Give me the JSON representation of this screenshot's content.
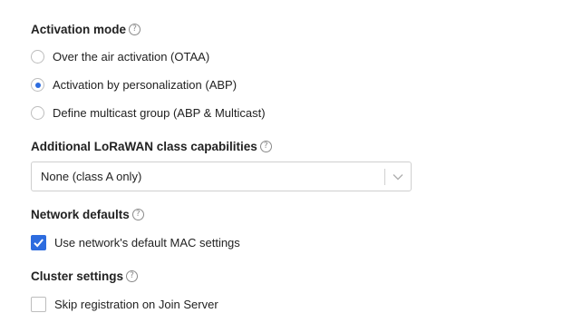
{
  "activation_mode": {
    "title": "Activation mode",
    "options": [
      {
        "label": "Over the air activation (OTAA)",
        "selected": false
      },
      {
        "label": "Activation by personalization (ABP)",
        "selected": true
      },
      {
        "label": "Define multicast group (ABP & Multicast)",
        "selected": false
      }
    ]
  },
  "class_capabilities": {
    "title": "Additional LoRaWAN class capabilities",
    "selected_value": "None (class A only)"
  },
  "network_defaults": {
    "title": "Network defaults",
    "checkbox_label": "Use network's default MAC settings",
    "checked": true
  },
  "cluster_settings": {
    "title": "Cluster settings",
    "checkbox_label": "Skip registration on Join Server",
    "checked": false
  },
  "colors": {
    "accent": "#2d6cdf",
    "border": "#bdbdbd",
    "text": "#222222",
    "help_icon": "#8a8a8a"
  },
  "icons": {
    "help": "question-circle-icon",
    "dropdown": "chevron-down-icon",
    "check": "checkmark-icon"
  }
}
